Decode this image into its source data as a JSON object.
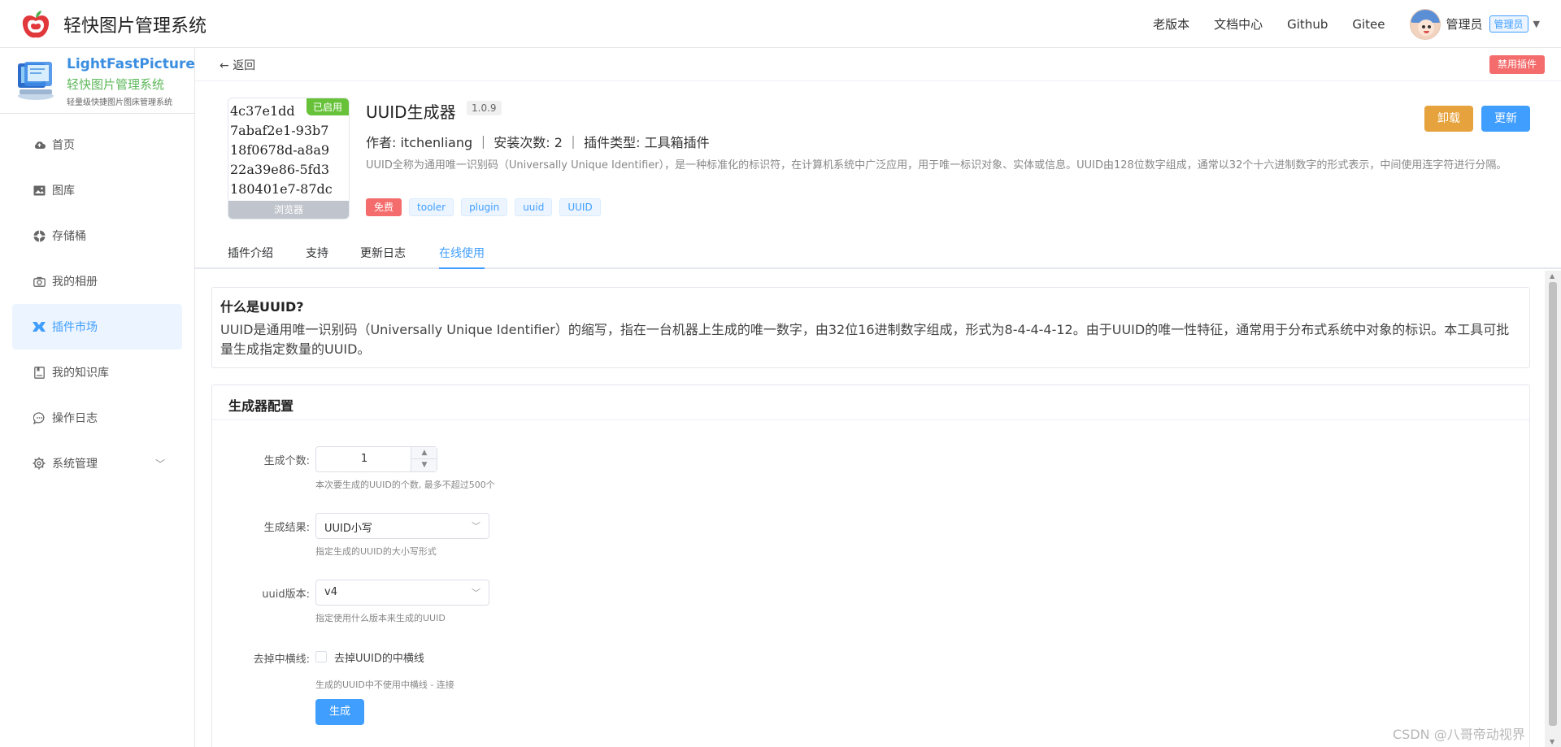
{
  "header": {
    "app_title": "轻快图片管理系统",
    "nav": [
      "老版本",
      "文档中心",
      "Github",
      "Gitee"
    ],
    "user_name": "管理员",
    "user_role": "管理员"
  },
  "sidebar": {
    "brand_name": "LightFastPicture",
    "brand_sub": "轻快图片管理系统",
    "brand_desc": "轻量级快捷图片图床管理系统",
    "items": [
      {
        "label": "首页",
        "icon": "cloud-icon"
      },
      {
        "label": "图库",
        "icon": "image-icon"
      },
      {
        "label": "存储桶",
        "icon": "bucket-icon"
      },
      {
        "label": "我的相册",
        "icon": "camera-icon"
      },
      {
        "label": "插件市场",
        "icon": "plugin-icon",
        "active": true
      },
      {
        "label": "我的知识库",
        "icon": "book-icon"
      },
      {
        "label": "操作日志",
        "icon": "chat-icon"
      },
      {
        "label": "系统管理",
        "icon": "gear-icon"
      }
    ]
  },
  "page": {
    "back": "返回",
    "disable_plugin": "禁用插件"
  },
  "plugin": {
    "thumb_lines": [
      "4c37e1dd",
      "7abaf2e1-93b7",
      "18f0678d-a8a9",
      "22a39e86-5fd3",
      "180401e7-87dc"
    ],
    "enabled_badge": "已启用",
    "thumb_caption": "浏览器",
    "name": "UUID生成器",
    "version": "1.0.9",
    "meta": "作者: itchenliang ｜ 安装次数: 2 ｜ 插件类型: 工具箱插件",
    "description": "UUID全称为通用唯一识别码（Universally Unique Identifier），是一种标准化的标识符，在计算机系统中广泛应用，用于唯一标识对象、实体或信息。UUID由128位数字组成，通常以32个十六进制数字的形式表示，中间使用连字符进行分隔。",
    "tags": [
      "免费",
      "tooler",
      "plugin",
      "uuid",
      "UUID"
    ],
    "uninstall": "卸载",
    "update": "更新"
  },
  "tabs": [
    "插件介绍",
    "支持",
    "更新日志",
    "在线使用"
  ],
  "info": {
    "title": "什么是UUID?",
    "text": "UUID是通用唯一识别码（Universally Unique Identifier）的缩写，指在一台机器上生成的唯一数字，由32位16进制数字组成，形式为8-4-4-4-12。由于UUID的唯一性特征，通常用于分布式系统中对象的标识。本工具可批量生成指定数量的UUID。"
  },
  "generator": {
    "title": "生成器配置",
    "count_label": "生成个数:",
    "count_value": "1",
    "count_help": "本次要生成的UUID的个数, 最多不超过500个",
    "result_label": "生成结果:",
    "result_value": "UUID小写",
    "result_help": "指定生成的UUID的大小写形式",
    "version_label": "uuid版本:",
    "version_value": "v4",
    "version_help": "指定使用什么版本来生成的UUID",
    "dash_label": "去掉中横线:",
    "dash_checkbox_label": "去掉UUID的中横线",
    "dash_help": "生成的UUID中不使用中横线 - 连接",
    "generate_button": "生成"
  },
  "watermark": "CSDN @八哥帝动视界"
}
